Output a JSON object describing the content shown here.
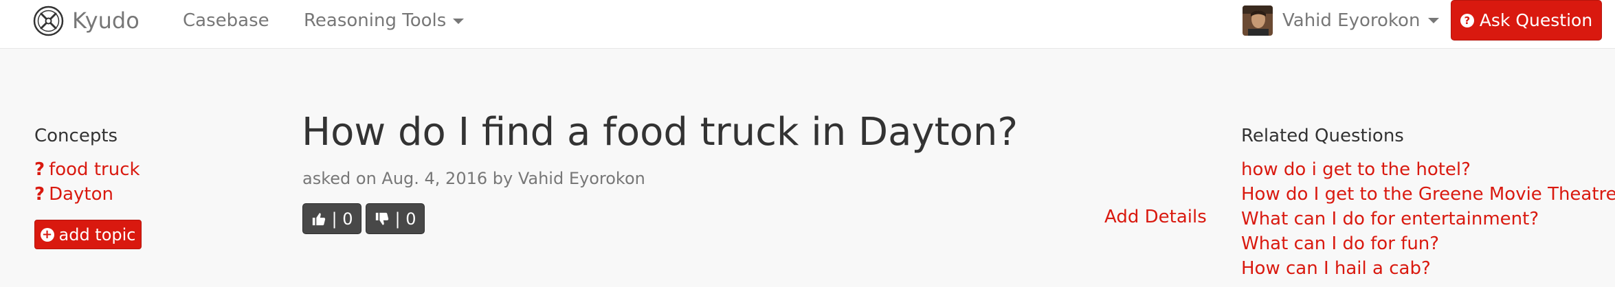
{
  "navbar": {
    "brand": "Kyudo",
    "links": [
      {
        "label": "Casebase"
      },
      {
        "label": "Reasoning Tools"
      }
    ],
    "user_name": "Vahid Eyorokon",
    "ask_button": "Ask Question"
  },
  "concepts": {
    "heading": "Concepts",
    "items": [
      "food truck",
      "Dayton"
    ],
    "add_topic": "add topic"
  },
  "question": {
    "title": "How do I find a food truck in Dayton?",
    "asked_meta": "asked on Aug. 4, 2016 by Vahid Eyorokon",
    "upvotes": "| 0",
    "downvotes": "| 0",
    "add_details": "Add Details"
  },
  "related": {
    "heading": "Related Questions",
    "items": [
      "how do i get to the hotel?",
      "How do I get to the Greene Movie Theatre?",
      "What can I do for entertainment?",
      "What can I do for fun?",
      "How can I hail a cab?"
    ]
  },
  "colors": {
    "accent": "#d9190f",
    "vote_button": "#484848",
    "page_background": "#f8f8f8",
    "muted_text": "#777777"
  },
  "icons": {
    "brand": "kyudo-logo-icon",
    "caret": "caret-down-icon",
    "ask": "question-circle-icon",
    "concept": "question-mark-icon",
    "add_topic": "plus-circle-icon",
    "upvote": "thumbs-up-icon",
    "downvote": "thumbs-down-icon"
  }
}
